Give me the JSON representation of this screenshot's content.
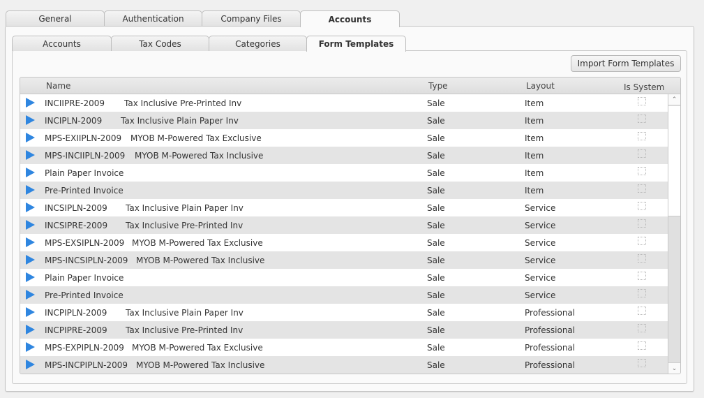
{
  "outer_tabs": [
    {
      "label": "General",
      "active": false
    },
    {
      "label": "Authentication",
      "active": false
    },
    {
      "label": "Company Files",
      "active": false
    },
    {
      "label": "Accounts",
      "active": true
    }
  ],
  "inner_tabs": [
    {
      "label": "Accounts",
      "active": false
    },
    {
      "label": "Tax Codes",
      "active": false
    },
    {
      "label": "Categories",
      "active": false
    },
    {
      "label": "Form Templates",
      "active": true
    }
  ],
  "toolbar": {
    "import_label": "Import Form Templates"
  },
  "grid": {
    "columns": {
      "name": "Name",
      "type": "Type",
      "layout": "Layout",
      "is_system": "Is System"
    },
    "rows": [
      {
        "code": "INCIIPRE-2009",
        "description": "Tax Inclusive Pre-Printed Inv",
        "type": "Sale",
        "layout": "Item",
        "is_system": false
      },
      {
        "code": "INCIPLN-2009",
        "description": "Tax Inclusive Plain Paper Inv",
        "type": "Sale",
        "layout": "Item",
        "is_system": false
      },
      {
        "code": "MPS-EXIIPLN-2009",
        "description": "MYOB M-Powered Tax Exclusive",
        "type": "Sale",
        "layout": "Item",
        "is_system": false
      },
      {
        "code": "MPS-INCIIPLN-2009",
        "description": "MYOB M-Powered Tax Inclusive",
        "type": "Sale",
        "layout": "Item",
        "is_system": false
      },
      {
        "code": "Plain Paper Invoice",
        "description": "",
        "type": "Sale",
        "layout": "Item",
        "is_system": false
      },
      {
        "code": "Pre-Printed Invoice",
        "description": "",
        "type": "Sale",
        "layout": "Item",
        "is_system": false
      },
      {
        "code": "INCSIPLN-2009",
        "description": "Tax Inclusive Plain Paper Inv",
        "type": "Sale",
        "layout": "Service",
        "is_system": false
      },
      {
        "code": "INCSIPRE-2009",
        "description": "Tax Inclusive Pre-Printed Inv",
        "type": "Sale",
        "layout": "Service",
        "is_system": false
      },
      {
        "code": "MPS-EXSIPLN-2009",
        "description": "MYOB M-Powered Tax Exclusive",
        "type": "Sale",
        "layout": "Service",
        "is_system": false
      },
      {
        "code": "MPS-INCSIPLN-2009",
        "description": "MYOB M-Powered Tax Inclusive",
        "type": "Sale",
        "layout": "Service",
        "is_system": false
      },
      {
        "code": "Plain Paper Invoice",
        "description": "",
        "type": "Sale",
        "layout": "Service",
        "is_system": false
      },
      {
        "code": "Pre-Printed Invoice",
        "description": "",
        "type": "Sale",
        "layout": "Service",
        "is_system": false
      },
      {
        "code": "INCPIPLN-2009",
        "description": "Tax Inclusive Plain Paper Inv",
        "type": "Sale",
        "layout": "Professional",
        "is_system": false
      },
      {
        "code": "INCPIPRE-2009",
        "description": "Tax Inclusive Pre-Printed Inv",
        "type": "Sale",
        "layout": "Professional",
        "is_system": false
      },
      {
        "code": "MPS-EXPIPLN-2009",
        "description": "MYOB M-Powered Tax Exclusive",
        "type": "Sale",
        "layout": "Professional",
        "is_system": false
      },
      {
        "code": "MPS-INCPIPLN-2009",
        "description": "MYOB M-Powered Tax Inclusive",
        "type": "Sale",
        "layout": "Professional",
        "is_system": false
      }
    ]
  },
  "scrollbar": {
    "up_icon": "⌃",
    "down_icon": "⌄"
  },
  "colors": {
    "accent_arrow": "#2f86e0"
  }
}
